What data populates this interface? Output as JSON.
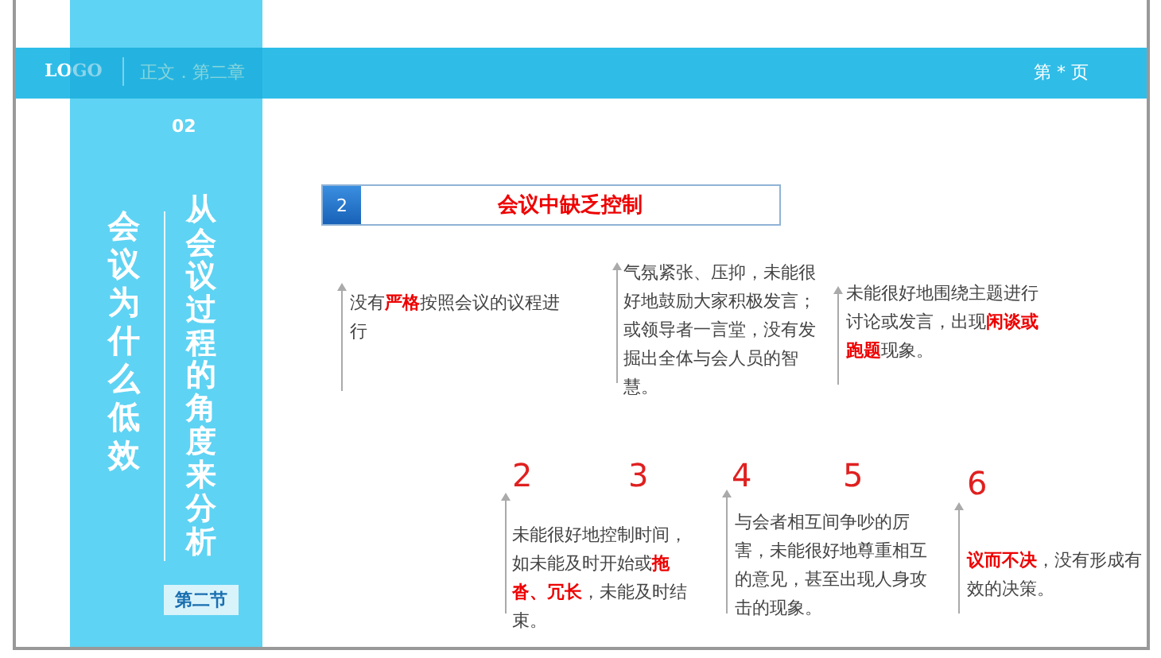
{
  "header": {
    "logo": "LOGO",
    "chapter": "正文．第二章",
    "page": "第 * 页"
  },
  "sidebar": {
    "number": "02",
    "title": "会议为什么低效",
    "subtitle": "从会议过程的角度来分析",
    "section": "第二节"
  },
  "heading": {
    "number": "2",
    "title": "会议中缺乏控制"
  },
  "points_top": [
    {
      "text": "没有**严格**按照会议的议程进行"
    },
    {
      "text": "气氛紧张、压抑，未能很好地鼓励大家积极发言；或领导者一言堂，没有发掘出全体与会人员的智慧。"
    },
    {
      "text": "未能很好地围绕主题进行讨论或发言，出现**闲谈或跑题**现象。"
    }
  ],
  "numbers": [
    "2",
    "3",
    "4",
    "5",
    "6"
  ],
  "points_bottom": [
    {
      "text": "未能很好地控制时间，如未能及时开始或**拖沓、冗长**，未能及时结束。"
    },
    {
      "text": "与会者相互间争吵的厉害，未能很好地尊重相互的意见，甚至出现人身攻击的现象。"
    },
    {
      "text": "**议而不决**，没有形成有效的决策。"
    }
  ]
}
